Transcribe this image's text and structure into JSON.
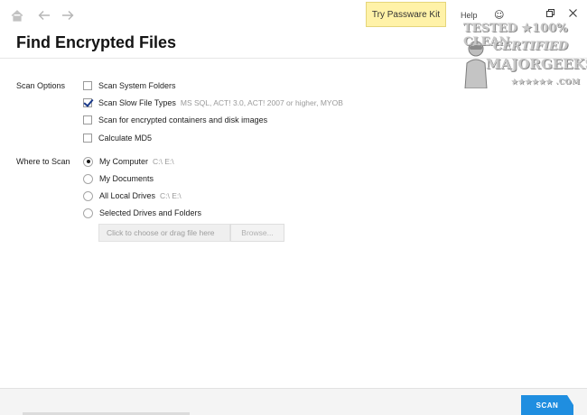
{
  "titlebar": {
    "home_icon": "home-icon",
    "back_icon": "arrow-left-icon",
    "forward_icon": "arrow-right-icon",
    "promo_label": "Try Passware Kit",
    "help_label": "Help",
    "feedback_icon": "smiley-icon",
    "restore_icon": "restore-icon",
    "close_icon": "close-icon"
  },
  "header": {
    "title": "Find Encrypted Files"
  },
  "scan_options": {
    "label": "Scan Options",
    "items": [
      {
        "label": "Scan System Folders",
        "checked": false,
        "hint": ""
      },
      {
        "label": "Scan Slow File Types",
        "checked": true,
        "hint": "MS SQL, ACT! 3.0, ACT! 2007 or higher, MYOB"
      },
      {
        "label": "Scan for encrypted containers and disk images",
        "checked": false,
        "hint": ""
      },
      {
        "label": "Calculate MD5",
        "checked": false,
        "hint": ""
      }
    ]
  },
  "where_to_scan": {
    "label": "Where to Scan",
    "items": [
      {
        "label": "My Computer",
        "selected": true,
        "hint": "C:\\ E:\\"
      },
      {
        "label": "My Documents",
        "selected": false,
        "hint": ""
      },
      {
        "label": "All Local Drives",
        "selected": false,
        "hint": "C:\\ E:\\"
      },
      {
        "label": "Selected Drives and Folders",
        "selected": false,
        "hint": ""
      }
    ],
    "file_placeholder": "Click to choose or drag file here",
    "browse_label": "Browse..."
  },
  "footer": {
    "scan_label": "SCAN"
  },
  "watermark": {
    "line1": "TESTED ★100% CLEAN",
    "line2": "CERTIFIED",
    "line3": "MAJORGEEKS",
    "line4": "★★★★★★ .COM"
  },
  "colors": {
    "accent": "#1f8ee0",
    "promo_bg": "#fff2a8"
  }
}
